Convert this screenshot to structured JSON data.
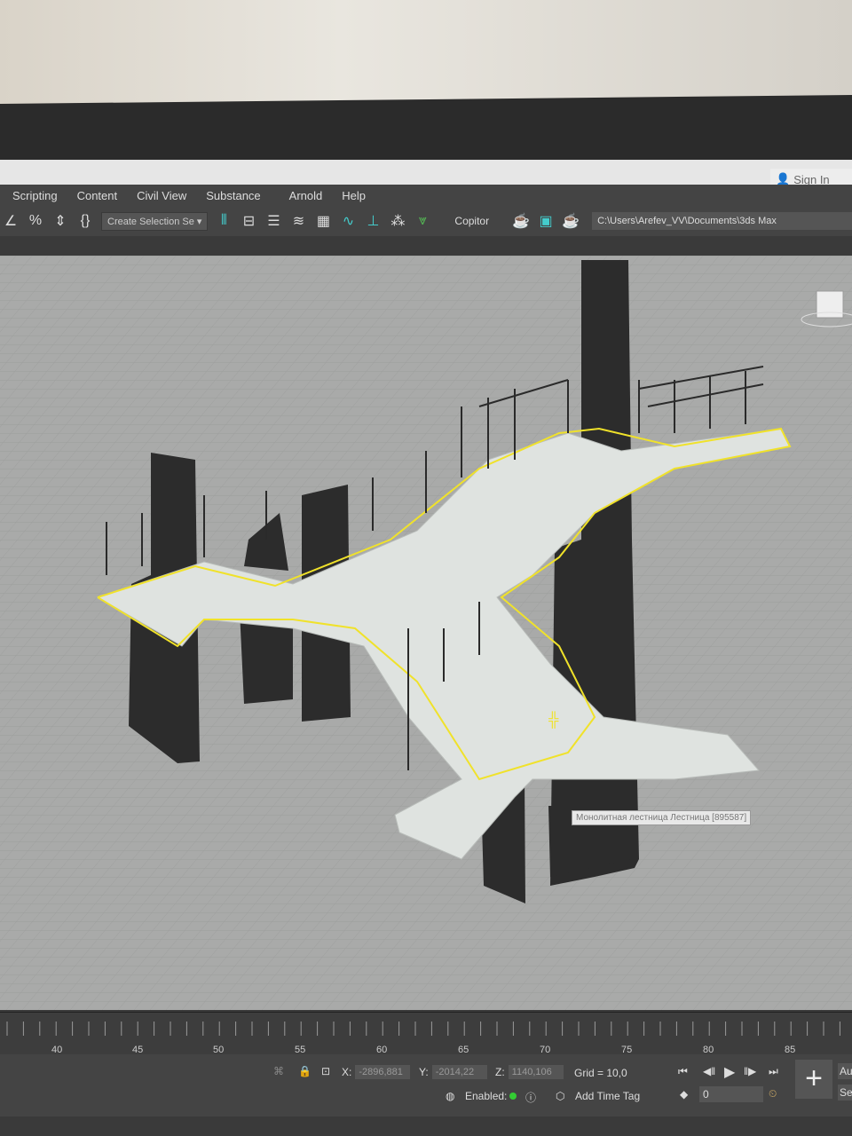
{
  "title_bar": {
    "sign_in": "Sign In"
  },
  "menu": [
    "Scripting",
    "Content",
    "Civil View",
    "Substance",
    "Arnold",
    "Help"
  ],
  "toolbar": {
    "selection_set": "Create Selection Se",
    "copitor": "Copitor",
    "path": "C:\\Users\\Arefev_VV\\Documents\\3ds Max"
  },
  "viewport": {
    "tooltip": "Монолитная лестница Лестница [895587]",
    "selection_color": "#f0e22a"
  },
  "timeline": {
    "ticks": [
      "40",
      "45",
      "50",
      "55",
      "60",
      "65",
      "70",
      "75",
      "80",
      "85"
    ]
  },
  "status": {
    "x_label": "X:",
    "x": "-2896,881",
    "y_label": "Y:",
    "y": "-2014,22",
    "z_label": "Z:",
    "z": "1140,106",
    "grid": "Grid = 10,0",
    "enabled": "Enabled:",
    "add_time_tag": "Add Time Tag",
    "frame": "0",
    "auto": "Au",
    "set": "Se"
  }
}
